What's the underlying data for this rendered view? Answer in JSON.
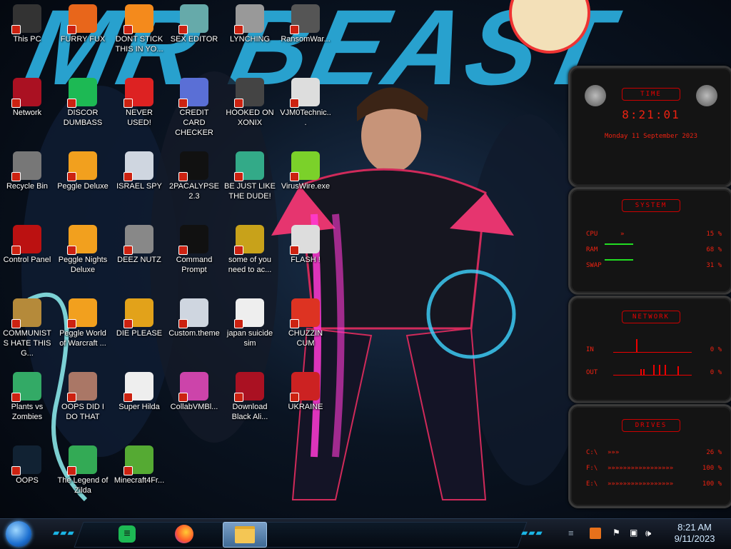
{
  "wallpaper": {
    "text": "MR BEAST"
  },
  "desktop_icons": [
    {
      "label": "This PC",
      "color": "#333"
    },
    {
      "label": "FURRY FUX",
      "color": "#e8661b"
    },
    {
      "label": "DONT STICK THIS IN YO...",
      "color": "#f48a1c"
    },
    {
      "label": "SEX EDITOR",
      "color": "#6aa"
    },
    {
      "label": "LYNCHING",
      "color": "#999"
    },
    {
      "label": "RansomWar...",
      "color": "#555"
    },
    {
      "label": "Network",
      "color": "#a12"
    },
    {
      "label": "DISCOR DUMBASS",
      "color": "#1db954"
    },
    {
      "label": "NEVER USED!",
      "color": "#d22"
    },
    {
      "label": "CREDIT CARD CHECKER",
      "color": "#5a6fd6"
    },
    {
      "label": "HOOKED ON XONIX",
      "color": "#444"
    },
    {
      "label": "VJM0Technic...",
      "color": "#ddd"
    },
    {
      "label": "Recycle Bin",
      "color": "#777"
    },
    {
      "label": "Peggle Deluxe",
      "color": "#f2a01e"
    },
    {
      "label": "ISRAEL SPY",
      "color": "#cfd6e0"
    },
    {
      "label": "2PACALYPSE 2.3",
      "color": "#111"
    },
    {
      "label": "BE JUST LIKE THE DUDE!",
      "color": "#3a8"
    },
    {
      "label": "VirusWire.exe",
      "color": "#7bd12a"
    },
    {
      "label": "Control Panel",
      "color": "#b11"
    },
    {
      "label": "Peggle Nights Deluxe",
      "color": "#f2a01e"
    },
    {
      "label": "DEEZ NUTZ",
      "color": "#888"
    },
    {
      "label": "Command Prompt",
      "color": "#111"
    },
    {
      "label": "some of you need to ac...",
      "color": "#c8a21a"
    },
    {
      "label": "FLASH !",
      "color": "#ddd"
    },
    {
      "label": "COMMUNISTS HATE THIS G...",
      "color": "#b58a3a"
    },
    {
      "label": "Peggle World of Warcraft ...",
      "color": "#f2a01e"
    },
    {
      "label": "DIE PLEASE",
      "color": "#e2a21a"
    },
    {
      "label": "Custom.theme",
      "color": "#cfd6e0"
    },
    {
      "label": "japan suicide sim",
      "color": "#eee"
    },
    {
      "label": "CHUZZIN CUM",
      "color": "#d32"
    },
    {
      "label": "Plants vs Zombies",
      "color": "#3a6"
    },
    {
      "label": "OOPS DID I DO THAT",
      "color": "#a76"
    },
    {
      "label": "Super Hilda",
      "color": "#eee"
    },
    {
      "label": "CollabVMBl...",
      "color": "#c4a"
    },
    {
      "label": "Download Black Ali...",
      "color": "#a12"
    },
    {
      "label": "UKRAINE",
      "color": "#c22"
    },
    {
      "label": "OOPS",
      "color": "#123"
    },
    {
      "label": "The Legend of Zilda",
      "color": "#3a5"
    },
    {
      "label": "Minecraft4Fr...",
      "color": "#5a3"
    }
  ],
  "widgets": {
    "time": {
      "title": "TIME",
      "time": "8:21:01",
      "date": "Monday 11 September 2023"
    },
    "system": {
      "title": "SYSTEM",
      "rows": [
        {
          "label": "CPU",
          "value": "15 %"
        },
        {
          "label": "RAM",
          "value": "68 %"
        },
        {
          "label": "SWAP",
          "value": "31 %"
        }
      ]
    },
    "network": {
      "title": "NETWORK",
      "rows": [
        {
          "label": "IN",
          "value": "0 %"
        },
        {
          "label": "OUT",
          "value": "0 %"
        }
      ]
    },
    "drives": {
      "title": "DRIVES",
      "rows": [
        {
          "label": "C:\\",
          "value": "26 %"
        },
        {
          "label": "F:\\",
          "value": "100 %"
        },
        {
          "label": "E:\\",
          "value": "100 %"
        }
      ]
    }
  },
  "taskbar": {
    "pinned": [
      "discord-icon",
      "firefox-icon",
      "file-explorer-icon"
    ],
    "clock_time": "8:21 AM",
    "clock_date": "9/11/2023"
  },
  "colors": {
    "accent": "#1bb6e6",
    "widget_red": "#e21"
  }
}
